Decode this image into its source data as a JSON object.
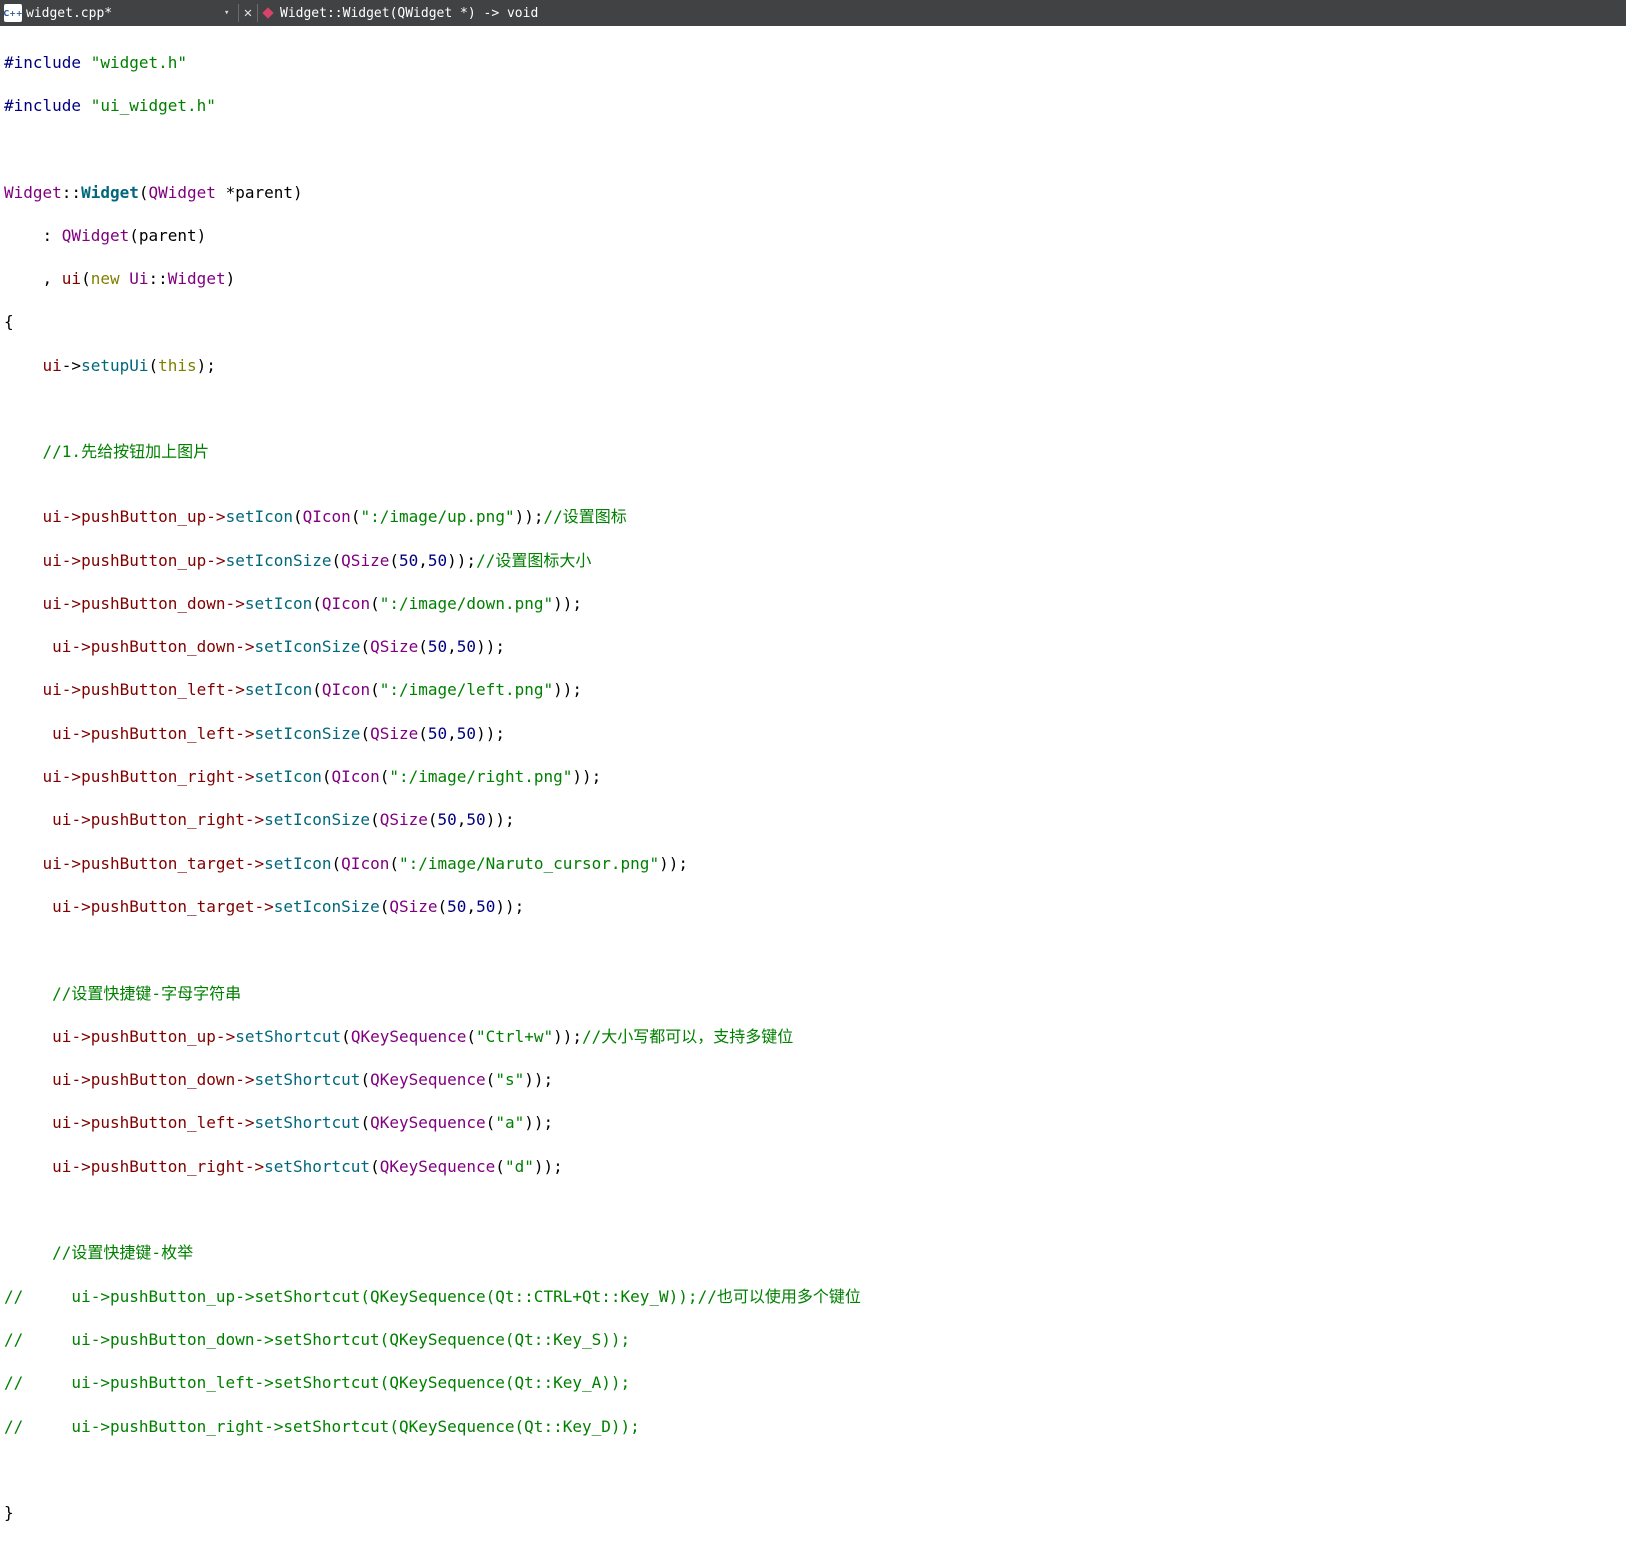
{
  "toolbar": {
    "file_icon_text": "C++",
    "file_name": "widget.cpp*",
    "dropdown": "▾",
    "close": "✕",
    "symbol": "Widget::Widget(QWidget *) -> void"
  },
  "code": {
    "l1a": "#include ",
    "l1b": "\"widget.h\"",
    "l2a": "#include ",
    "l2b": "\"ui_widget.h\"",
    "l4a": "Widget",
    "l4b": "::",
    "l4c": "Widget",
    "l4d": "(",
    "l4e": "QWidget",
    "l4f": " *parent)",
    "l5a": "    : ",
    "l5b": "QWidget",
    "l5c": "(parent)",
    "l6a": "    , ",
    "l6b": "ui",
    "l6c": "(",
    "l6d": "new",
    "l6e": " ",
    "l6f": "Ui",
    "l6g": "::",
    "l6h": "Widget",
    "l6i": ")",
    "l7": "{",
    "l8a": "    ui",
    "l8b": "->",
    "l8c": "setupUi",
    "l8d": "(",
    "l8e": "this",
    "l8f": ");",
    "l10": "    //1.先给按钮加上图片",
    "l11_indent": "    ",
    "l11a": "ui->pushButton_up->",
    "l11b": "setIcon",
    "l11c": "(",
    "l11d": "QIcon",
    "l11e": "(",
    "l11f": "\":/image/up.png\"",
    "l11g": "));",
    "l11h": "//设置图标",
    "l12_indent": "    ",
    "l12a": "ui->pushButton_up->",
    "l12b": "setIconSize",
    "l12c": "(",
    "l12d": "QSize",
    "l12e": "(",
    "l12f": "50",
    "l12g": ",",
    "l12h": "50",
    "l12i": "));",
    "l12j": "//设置图标大小",
    "l13_indent": "    ",
    "l13a": "ui->pushButton_down->",
    "l13b": "setIcon",
    "l13c": "(",
    "l13d": "QIcon",
    "l13e": "(",
    "l13f": "\":/image/down.png\"",
    "l13g": "));",
    "l14_indent": "     ",
    "l14a": "ui->pushButton_down->",
    "l14b": "setIconSize",
    "l14c": "(",
    "l14d": "QSize",
    "l14e": "(",
    "l14f": "50",
    "l14g": ",",
    "l14h": "50",
    "l14i": "));",
    "l15_indent": "    ",
    "l15a": "ui->pushButton_left->",
    "l15b": "setIcon",
    "l15c": "(",
    "l15d": "QIcon",
    "l15e": "(",
    "l15f": "\":/image/left.png\"",
    "l15g": "));",
    "l16_indent": "     ",
    "l16a": "ui->pushButton_left->",
    "l16b": "setIconSize",
    "l16c": "(",
    "l16d": "QSize",
    "l16e": "(",
    "l16f": "50",
    "l16g": ",",
    "l16h": "50",
    "l16i": "));",
    "l17_indent": "    ",
    "l17a": "ui->pushButton_right->",
    "l17b": "setIcon",
    "l17c": "(",
    "l17d": "QIcon",
    "l17e": "(",
    "l17f": "\":/image/right.png\"",
    "l17g": "));",
    "l18_indent": "     ",
    "l18a": "ui->pushButton_right->",
    "l18b": "setIconSize",
    "l18c": "(",
    "l18d": "QSize",
    "l18e": "(",
    "l18f": "50",
    "l18g": ",",
    "l18h": "50",
    "l18i": "));",
    "l19_indent": "    ",
    "l19a": "ui->pushButton_target->",
    "l19b": "setIcon",
    "l19c": "(",
    "l19d": "QIcon",
    "l19e": "(",
    "l19f": "\":/image/Naruto_cursor.png\"",
    "l19g": "));",
    "l20_indent": "     ",
    "l20a": "ui->pushButton_target->",
    "l20b": "setIconSize",
    "l20c": "(",
    "l20d": "QSize",
    "l20e": "(",
    "l20f": "50",
    "l20g": ",",
    "l20h": "50",
    "l20i": "));",
    "l22": "     //设置快捷键-字母字符串",
    "l23_indent": "     ",
    "l23a": "ui->pushButton_up->",
    "l23b": "setShortcut",
    "l23c": "(",
    "l23d": "QKeySequence",
    "l23e": "(",
    "l23f": "\"Ctrl+w\"",
    "l23g": "));",
    "l23h": "//大小写都可以，支持多键位",
    "l24_indent": "     ",
    "l24a": "ui->pushButton_down->",
    "l24b": "setShortcut",
    "l24c": "(",
    "l24d": "QKeySequence",
    "l24e": "(",
    "l24f": "\"s\"",
    "l24g": "));",
    "l25_indent": "     ",
    "l25a": "ui->pushButton_left->",
    "l25b": "setShortcut",
    "l25c": "(",
    "l25d": "QKeySequence",
    "l25e": "(",
    "l25f": "\"a\"",
    "l25g": "));",
    "l26_indent": "     ",
    "l26a": "ui->pushButton_right->",
    "l26b": "setShortcut",
    "l26c": "(",
    "l26d": "QKeySequence",
    "l26e": "(",
    "l26f": "\"d\"",
    "l26g": "));",
    "l28": "     //设置快捷键-枚举",
    "l29": "//     ui->pushButton_up->setShortcut(QKeySequence(Qt::CTRL+Qt::Key_W));//也可以使用多个键位",
    "l30": "//     ui->pushButton_down->setShortcut(QKeySequence(Qt::Key_S));",
    "l31": "//     ui->pushButton_left->setShortcut(QKeySequence(Qt::Key_A));",
    "l32": "//     ui->pushButton_right->setShortcut(QKeySequence(Qt::Key_D));",
    "l34": "}"
  }
}
